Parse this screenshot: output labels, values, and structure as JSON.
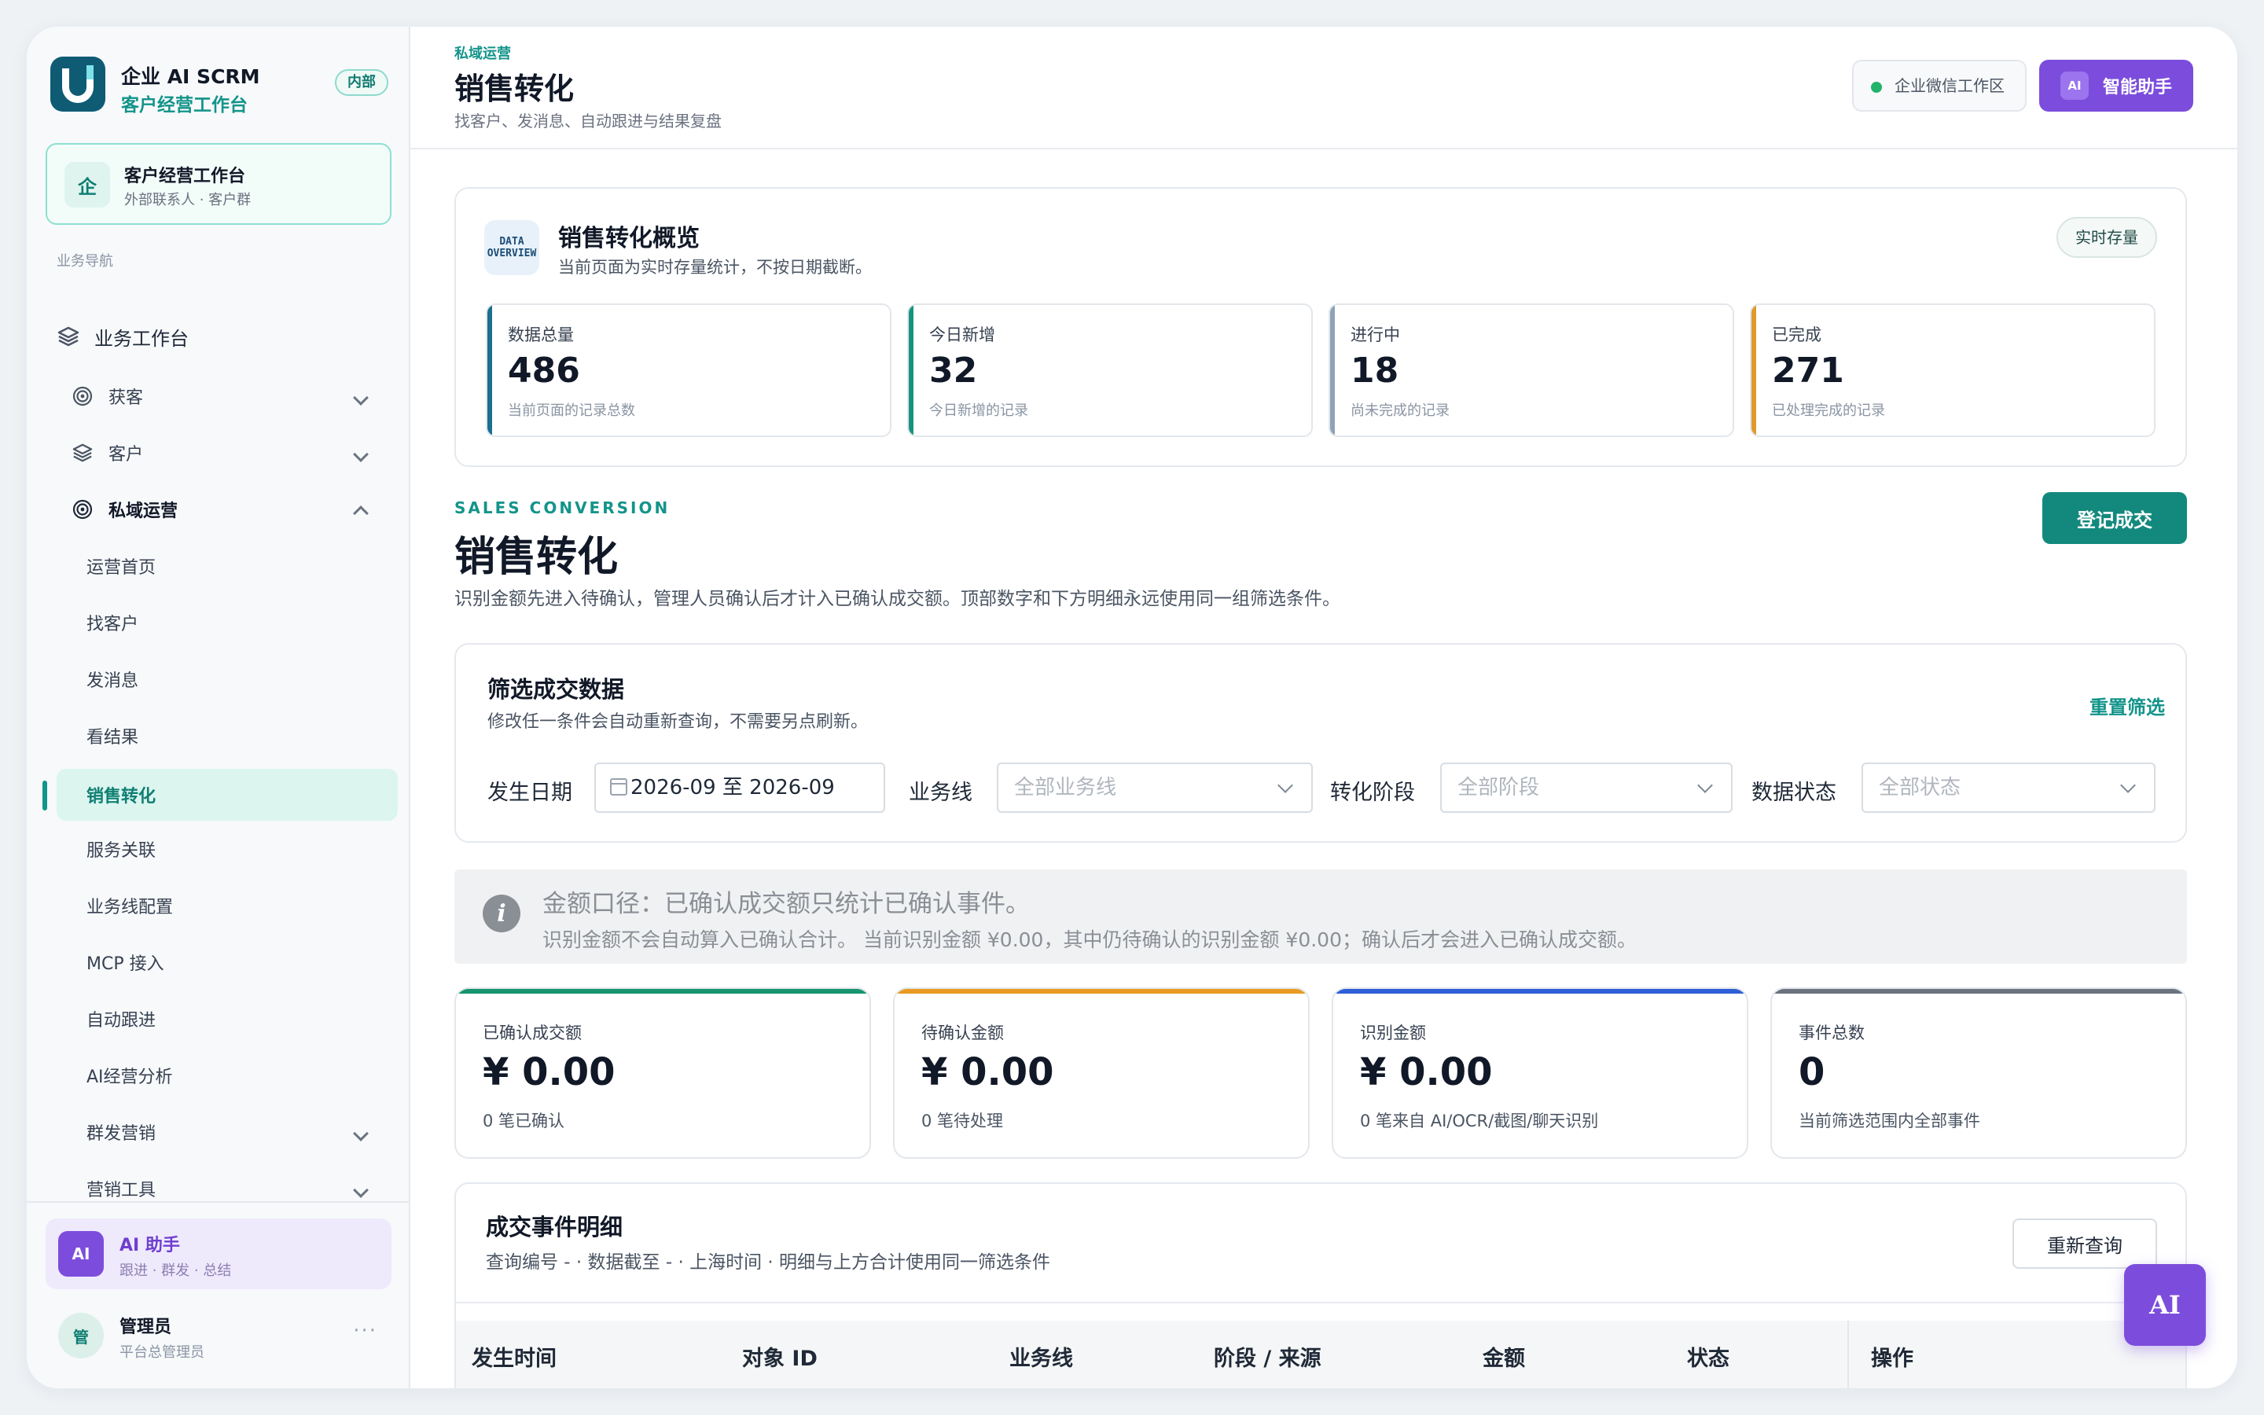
{
  "brand": {
    "title": "企业 AI SCRM",
    "subtitle": "客户经营工作台",
    "badge": "内部"
  },
  "workspace": {
    "icon_text": "企",
    "title": "客户经营工作台",
    "subtitle": "外部联系人 · 客户群"
  },
  "nav": {
    "caption": "业务导航",
    "workbench": "业务工作台",
    "groups": {
      "acquire": "获客",
      "customer": "客户",
      "private": "私域运营",
      "mass": "群发营销",
      "tools": "营销工具"
    },
    "private_items": [
      "运营首页",
      "找客户",
      "发消息",
      "看结果",
      "销售转化",
      "服务关联",
      "业务线配置",
      "MCP 接入",
      "自动跟进",
      "AI经营分析"
    ]
  },
  "ai_assistant": {
    "avatar": "AI",
    "title": "AI 助手",
    "subtitle": "跟进 · 群发 · 总结"
  },
  "user": {
    "avatar": "管",
    "name": "管理员",
    "role": "平台总管理员",
    "more": "···"
  },
  "header": {
    "breadcrumb": "私域运营",
    "title": "销售转化",
    "subtitle": "找客户、发消息、自动跟进与结果复盘",
    "wecom_label": "企业微信工作区",
    "ai_mini": "AI",
    "ai_button": "智能助手"
  },
  "overview": {
    "icon_text_1": "DATA",
    "icon_text_2": "OVERVIEW",
    "title": "销售转化概览",
    "subtitle": "当前页面为实时存量统计，不按日期截断。",
    "badge": "实时存量",
    "stats": [
      {
        "label": "数据总量",
        "value": "486",
        "desc": "当前页面的记录总数",
        "color": "#1b6f8f"
      },
      {
        "label": "今日新增",
        "value": "32",
        "desc": "今日新增的记录",
        "color": "#17947f"
      },
      {
        "label": "进行中",
        "value": "18",
        "desc": "尚未完成的记录",
        "color": "#8fa2b7"
      },
      {
        "label": "已完成",
        "value": "271",
        "desc": "已处理完成的记录",
        "color": "#e09a2a"
      }
    ]
  },
  "section": {
    "eyebrow": "SALES CONVERSION",
    "title": "销售转化",
    "description": "识别金额先进入待确认，管理人员确认后才计入已确认成交额。顶部数字和下方明细永远使用同一组筛选条件。",
    "primary_button": "登记成交"
  },
  "filter": {
    "title": "筛选成交数据",
    "subtitle": "修改任一条件会自动重新查询，不需要另点刷新。",
    "reset": "重置筛选",
    "date_label": "发生日期",
    "date_value": "2026-09 至 2026-09",
    "line_label": "业务线",
    "line_placeholder": "全部业务线",
    "stage_label": "转化阶段",
    "stage_placeholder": "全部阶段",
    "status_label": "数据状态",
    "status_placeholder": "全部状态"
  },
  "notice": {
    "icon": "i",
    "title": "金额口径：已确认成交额只统计已确认事件。",
    "text": "识别金额不会自动算入已确认合计。 当前识别金额 ¥0.00，其中仍待确认的识别金额 ¥0.00；确认后才会进入已确认成交额。"
  },
  "metrics": [
    {
      "label": "已确认成交额",
      "value": "¥ 0.00",
      "desc": "0 笔已确认",
      "color": "#16956f"
    },
    {
      "label": "待确认金额",
      "value": "¥ 0.00",
      "desc": "0 笔待处理",
      "color": "#e89a22"
    },
    {
      "label": "识别金额",
      "value": "¥ 0.00",
      "desc": "0 笔来自 AI/OCR/截图/聊天识别",
      "color": "#2f5fd6"
    },
    {
      "label": "事件总数",
      "value": "0",
      "desc": "当前筛选范围内全部事件",
      "color": "#6b7280"
    }
  ],
  "events": {
    "title": "成交事件明细",
    "subtitle": "查询编号 - · 数据截至 - · 上海时间 · 明细与上方合计使用同一筛选条件",
    "requery": "重新查询",
    "columns": [
      "发生时间",
      "对象 ID",
      "业务线",
      "阶段 / 来源",
      "金额",
      "状态",
      "操作"
    ]
  },
  "fab": "AI"
}
